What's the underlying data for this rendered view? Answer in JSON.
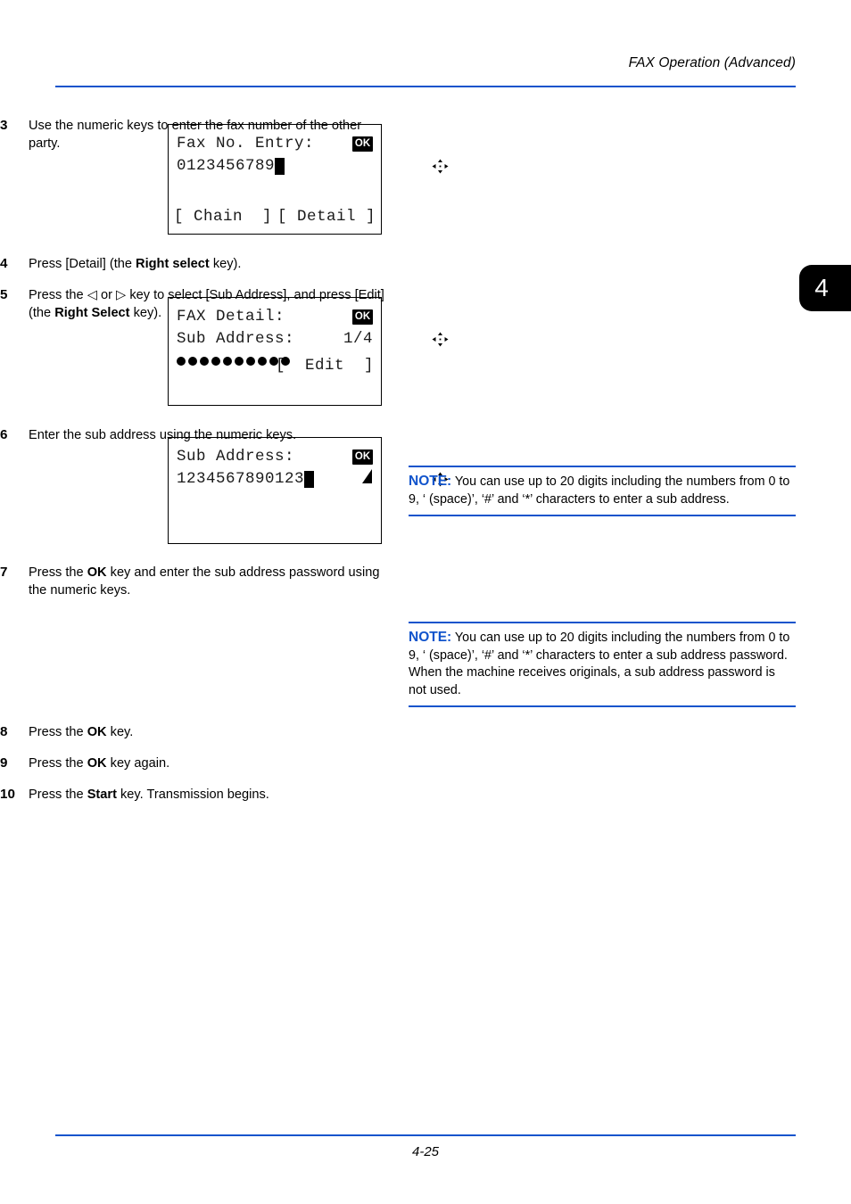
{
  "header": {
    "title": "FAX Operation (Advanced)"
  },
  "chapter_tab": {
    "number": "4"
  },
  "footer": {
    "page_number": "4-25"
  },
  "colors": {
    "rule_blue": "#1154cc",
    "note_label": "#1154cc",
    "tab_background": "#000000"
  },
  "panels": [
    {
      "name": "fax-no-entry",
      "title": "Fax No. Entry:",
      "value": "0123456789",
      "cursor": true,
      "icons": [
        "nav-arrows-icon",
        "ok-icon"
      ],
      "soft_keys": [
        "[ Chain  ]",
        "[ Detail ]"
      ]
    },
    {
      "name": "fax-detail",
      "title": "FAX Detail:",
      "row2_label": "Sub Address:",
      "row2_value": "1/4",
      "dots_count": 10,
      "icons": [
        "nav-arrows-icon",
        "ok-icon"
      ],
      "soft_key_right": "[  Edit  ]"
    },
    {
      "name": "sub-address-entry",
      "title": "Sub Address:",
      "value": "1234567890123",
      "cursor": true,
      "icons": [
        "nav-arrows-icon",
        "ok-icon"
      ],
      "scroll_indicator": "scroll-triangle-icon"
    }
  ],
  "steps": [
    {
      "number": "3",
      "text_parts": [
        {
          "t": "Use the numeric keys to enter the fax number of the other party.",
          "bold": false
        }
      ]
    },
    {
      "number": "4",
      "text_parts": [
        {
          "t": "Press [Detail] (the ",
          "bold": false
        },
        {
          "t": "Right select",
          "bold": true
        },
        {
          "t": " key).",
          "bold": false
        }
      ]
    },
    {
      "number": "5",
      "text_parts": [
        {
          "t": "Press the ",
          "bold": false
        },
        {
          "t": "◁",
          "bold": false
        },
        {
          "t": " or ",
          "bold": false
        },
        {
          "t": "▷",
          "bold": false
        },
        {
          "t": " key to select [Sub Address], and press [Edit] (the ",
          "bold": false
        },
        {
          "t": "Right Select",
          "bold": true
        },
        {
          "t": " key).",
          "bold": false
        }
      ]
    },
    {
      "number": "6",
      "text_parts": [
        {
          "t": "Enter the sub address using the numeric keys.",
          "bold": false
        }
      ]
    },
    {
      "number": "7",
      "text_parts": [
        {
          "t": "Press the ",
          "bold": false
        },
        {
          "t": "OK",
          "bold": true
        },
        {
          "t": " key and enter the sub address password using the numeric keys.",
          "bold": false
        }
      ]
    },
    {
      "number": "8",
      "text_parts": [
        {
          "t": "Press the ",
          "bold": false
        },
        {
          "t": "OK",
          "bold": true
        },
        {
          "t": " key.",
          "bold": false
        }
      ]
    },
    {
      "number": "9",
      "text_parts": [
        {
          "t": "Press the ",
          "bold": false
        },
        {
          "t": "OK",
          "bold": true
        },
        {
          "t": " key again.",
          "bold": false
        }
      ]
    },
    {
      "number": "10",
      "text_parts": [
        {
          "t": "Press the ",
          "bold": false
        },
        {
          "t": "Start",
          "bold": true
        },
        {
          "t": " key. Transmission begins.",
          "bold": false
        }
      ]
    }
  ],
  "notes": [
    {
      "label": "NOTE:",
      "body": " You can use up to 20 digits including the numbers from 0 to 9, ‘ (space)’, ‘#’ and ‘*’ characters to enter a sub address."
    },
    {
      "label": "NOTE:",
      "body": " You can use up to 20 digits including the numbers from 0 to 9, ‘ (space)’, ‘#’ and ‘*’ characters to enter a sub address password. When the machine receives originals, a sub address password is not used."
    }
  ]
}
